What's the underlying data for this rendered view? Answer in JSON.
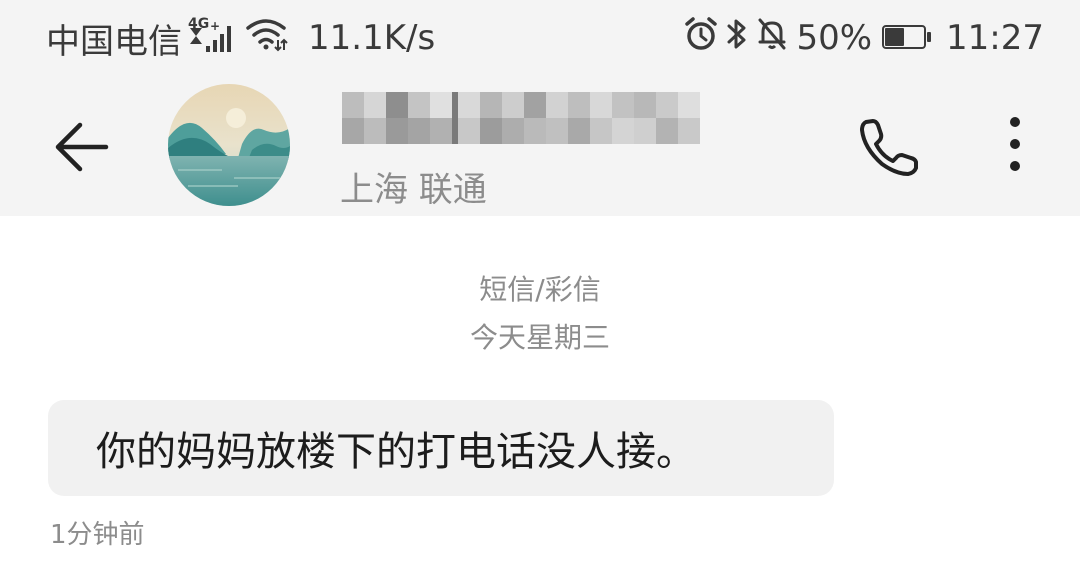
{
  "status_bar": {
    "carrier": "中国电信",
    "network_type": "4G",
    "net_speed": "11.1K/s",
    "battery_percent": "50%",
    "battery_level": 0.5,
    "time": "11:27",
    "icons": [
      "signal-icon",
      "wifi-icon",
      "alarm-icon",
      "bluetooth-icon",
      "mute-icon",
      "battery-icon"
    ]
  },
  "header": {
    "contact_name": "",
    "contact_location": "上海 联通",
    "icons": [
      "back-arrow-icon",
      "avatar",
      "phone-icon",
      "more-icon"
    ]
  },
  "conversation": {
    "message_type": "短信/彩信",
    "day_label": "今天星期三",
    "messages": [
      {
        "text": "你的妈妈放楼下的打电话没人接。",
        "time": "1分钟前"
      }
    ]
  },
  "colors": {
    "bar_background": "#f4f4f4",
    "bubble_background": "#f1f1f1",
    "secondary_text": "#8c8c8c",
    "primary_text": "#1c1c1c"
  }
}
